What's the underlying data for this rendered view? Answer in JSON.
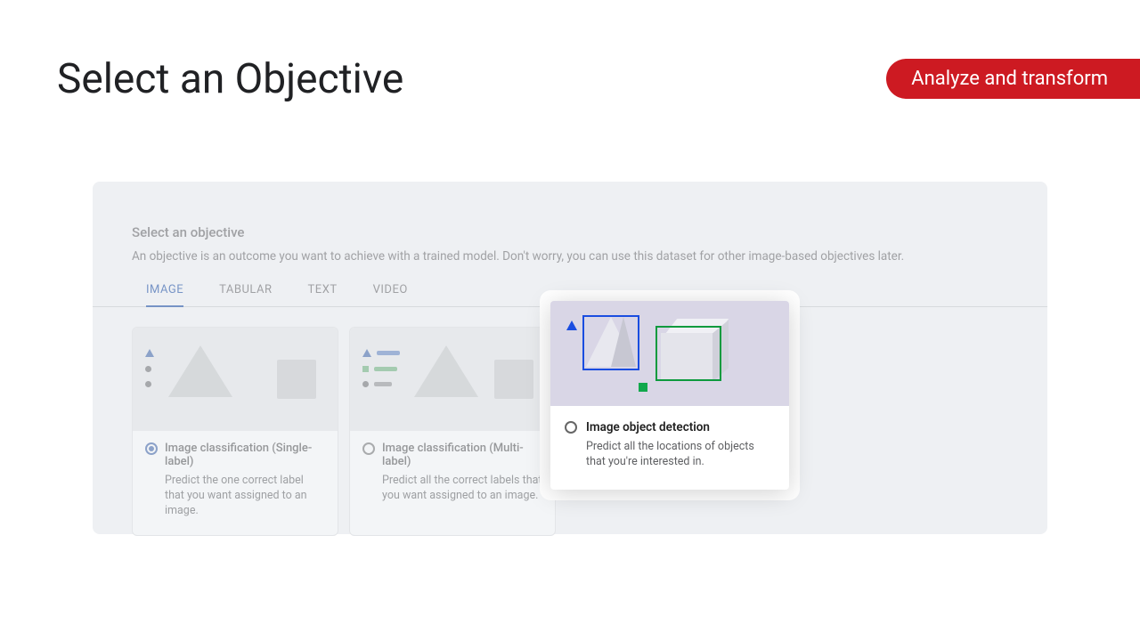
{
  "page": {
    "title": "Select an Objective",
    "banner": "Analyze and transform"
  },
  "dialog": {
    "title": "Select an objective",
    "description": "An objective is an outcome you want to achieve with a trained model. Don't worry, you can use this dataset for other image-based objectives later.",
    "tabs": [
      "IMAGE",
      "TABULAR",
      "TEXT",
      "VIDEO"
    ],
    "active_tab": 0
  },
  "cards": [
    {
      "title": "Image classification (Single-label)",
      "desc": "Predict the one correct label that you want assigned to an image.",
      "selected": true
    },
    {
      "title": "Image classification (Multi-label)",
      "desc": "Predict all the correct labels that you want assigned to an image.",
      "selected": false
    },
    {
      "title": "Image object detection",
      "desc": "Predict all the locations of objects that you're interested in.",
      "selected": false
    }
  ]
}
